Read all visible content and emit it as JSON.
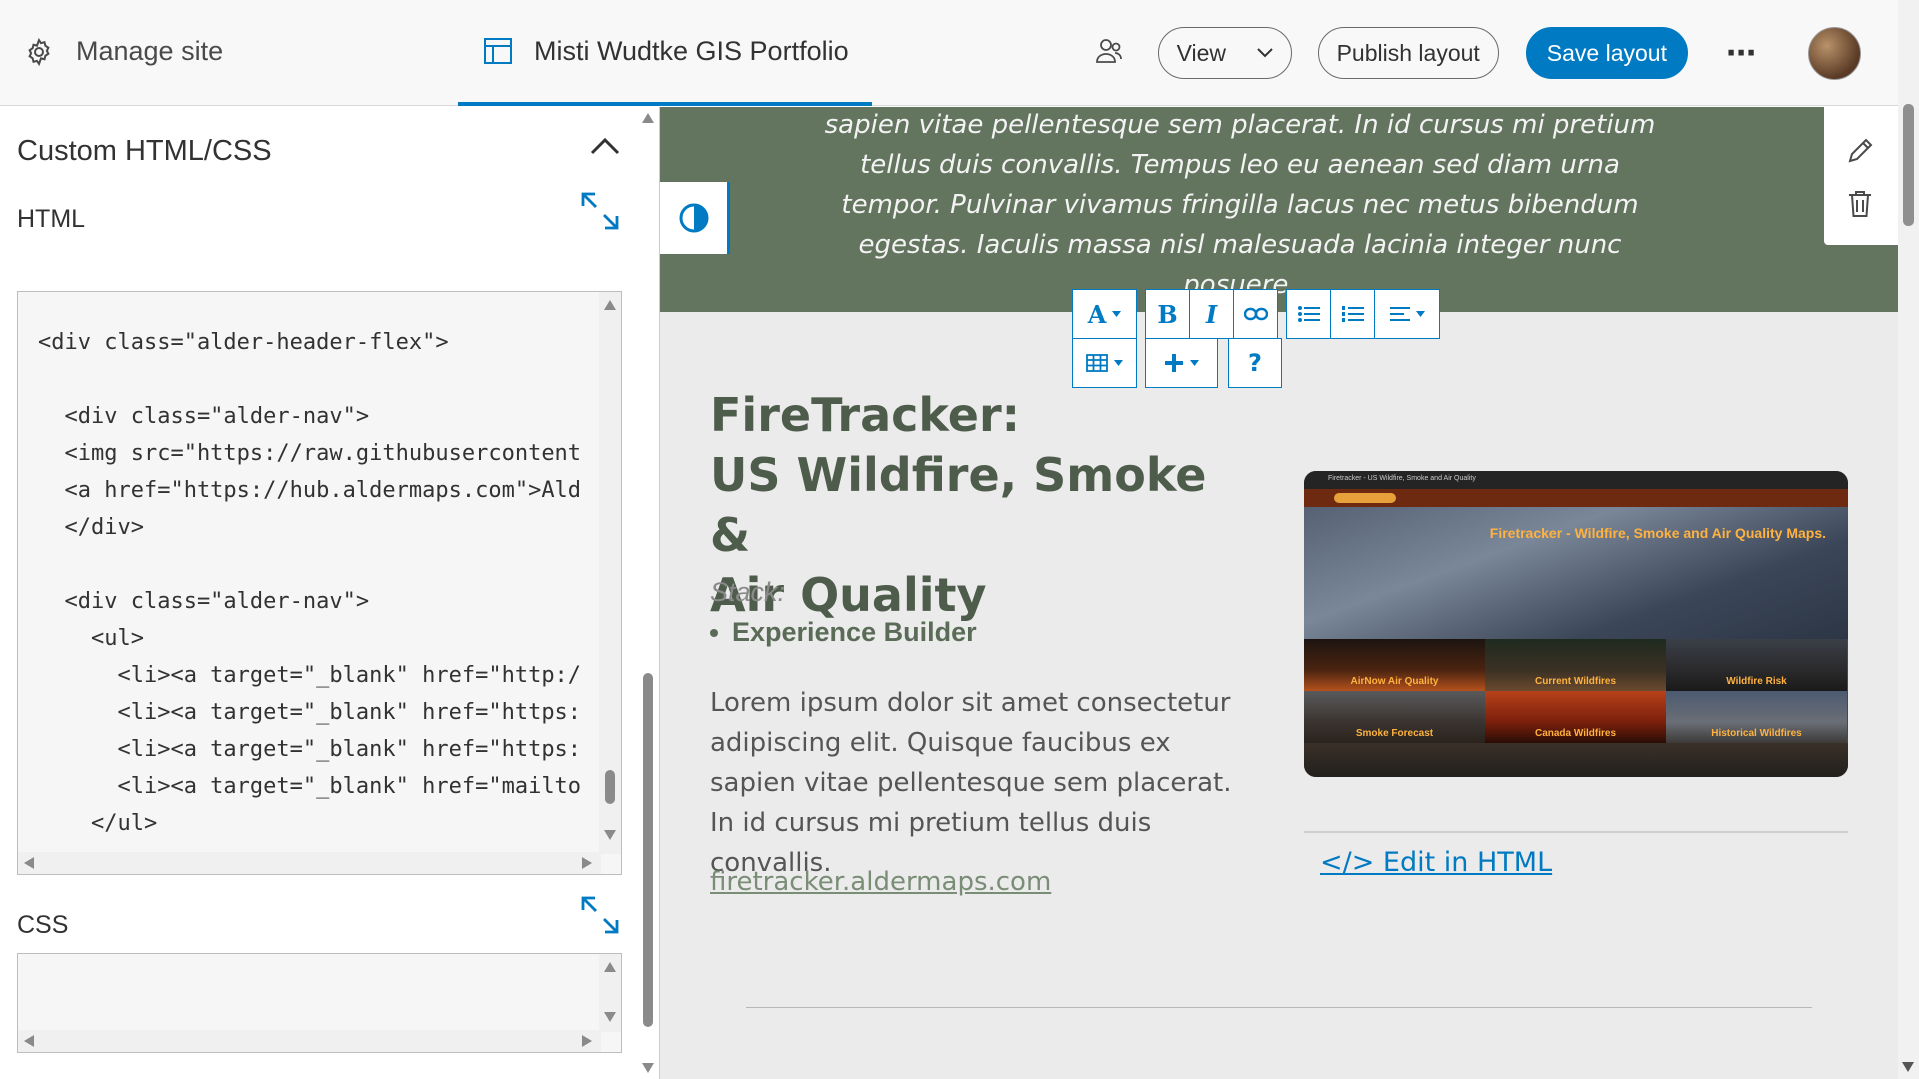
{
  "topbar": {
    "manage_label": "Manage site",
    "site_title": "Misti Wudtke GIS Portfolio",
    "view_label": "View",
    "publish_label": "Publish layout",
    "save_label": "Save layout",
    "more_label": "⋯"
  },
  "panel": {
    "title": "Custom HTML/CSS",
    "html_label": "HTML",
    "css_label": "CSS",
    "html_code": "<div class=\"alder-header-flex\">\n\n  <div class=\"alder-nav\">\n  <img src=\"https://raw.githubusercontent\n  <a href=\"https://hub.aldermaps.com\">Ald\n  </div>\n\n  <div class=\"alder-nav\">\n    <ul>\n      <li><a target=\"_blank\" href=\"http:/\n      <li><a target=\"_blank\" href=\"https:\n      <li><a target=\"_blank\" href=\"https:\n      <li><a target=\"_blank\" href=\"mailto\n    </ul>",
    "css_code": ""
  },
  "banner": {
    "text": "sapien vitae pellentesque sem placerat. In id cursus mi pretium tellus duis convallis. Tempus leo eu aenean sed diam urna tempor. Pulvinar vivamus fringilla lacus nec metus bibendum egestas. Iaculis massa nisl malesuada lacinia integer nunc posuere."
  },
  "card": {
    "title_line1": "FireTracker:",
    "title_line2": "US Wildfire, Smoke &",
    "title_line3": "Air Quality",
    "stack_label": "Stack:",
    "stack_item": "Experience Builder",
    "paragraph": "Lorem ipsum dolor sit amet consectetur adipiscing elit. Quisque faucibus ex sapien vitae pellentesque sem placerat. In id cursus mi pretium tellus duis convallis.",
    "link": "firetracker.aldermaps.com",
    "edit_html": "</> Edit in HTML"
  },
  "rte": {
    "font_btn": "A",
    "bold_btn": "B",
    "italic_btn": "I",
    "help_btn": "?"
  },
  "thumbnail": {
    "header": "Firetracker - US Wildfire, Smoke and Air Quality",
    "title": "Firetracker - Wildfire, Smoke and Air Quality Maps.",
    "tiles": [
      "AirNow Air Quality",
      "Current Wildfires",
      "Wildfire Risk",
      "Smoke Forecast",
      "Canada Wildfires",
      "Historical Wildfires"
    ]
  },
  "colors": {
    "accent": "#007ac2",
    "banner_green": "#63745f",
    "title_green": "#4e5c4b"
  }
}
